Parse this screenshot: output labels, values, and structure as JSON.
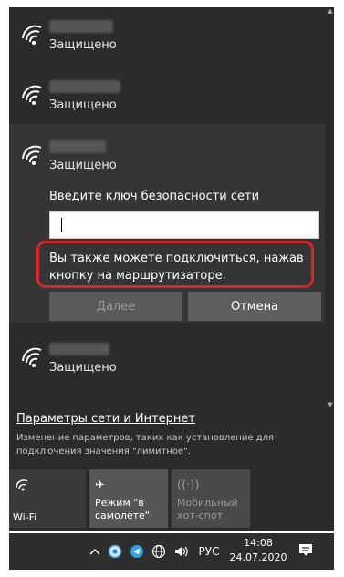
{
  "networks": [
    {
      "status": "Защищено"
    },
    {
      "status": "Защищено"
    },
    {
      "status": "Защищено",
      "connect": {
        "key_label": "Введите ключ безопасности сети",
        "key_value": "",
        "hint": "Вы также можете подключиться, нажав кнопку на маршрутизаторе.",
        "next_label": "Далее",
        "cancel_label": "Отмена"
      }
    },
    {
      "status": "Защищено"
    }
  ],
  "settings": {
    "link": "Параметры сети и Интернет",
    "description": "Изменение параметров, таких как установление для подключения значения \"лимитное\"."
  },
  "quick_actions": [
    {
      "label": "Wi-Fi",
      "icon": "wifi-icon"
    },
    {
      "label": "Режим \"в самолете\"",
      "icon": "airplane-icon"
    },
    {
      "label": "Мобильный хот-спот",
      "icon": "hotspot-icon"
    }
  ],
  "taskbar": {
    "language": "РУС",
    "time": "14:08",
    "date": "24.07.2020",
    "tray_icons": [
      "chevron-up-icon",
      "network-app-icon",
      "telegram-icon",
      "globe-icon",
      "volume-icon"
    ]
  }
}
